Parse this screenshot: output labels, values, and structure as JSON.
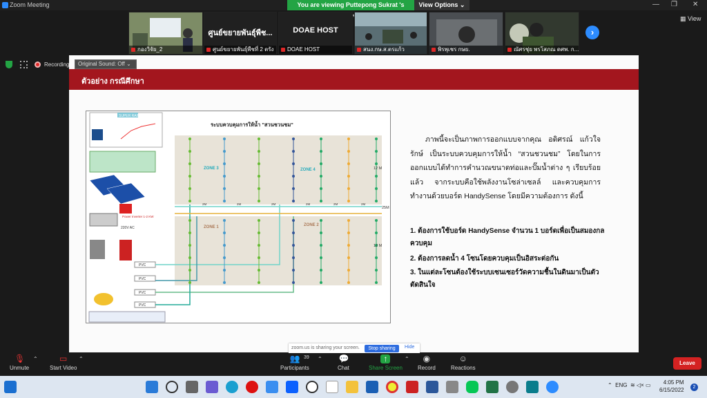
{
  "window": {
    "title": "Zoom Meeting",
    "viewing_banner": "You are viewing Puttepong Sukrat 's screen",
    "view_options": "View Options",
    "view_button": "View"
  },
  "participants_strip": [
    {
      "name": "กองวิจัย_2",
      "big": ""
    },
    {
      "name": "ศูนย์ขยายพันธุ์พืชที่ 2 ตรัง",
      "big": "ศูนย์ขยายพันธุ์พืช..."
    },
    {
      "name": "DOAE HOST",
      "big": "DOAE HOST"
    },
    {
      "name": "สนง.กษ.ส.ตรแก้ว",
      "big": ""
    },
    {
      "name": "พิรพุเชร กษย.",
      "big": ""
    },
    {
      "name": "ณัศรชุ่ย พรโสภณ ดศพ. ก...",
      "big": ""
    }
  ],
  "recording": {
    "label": "Recording",
    "original_sound": "Original Sound: Off"
  },
  "slide": {
    "header": "ตัวอย่าง กรณีศึกษา",
    "diagram": {
      "title": "ระบบควบคุมการให้น้ำ \"สวนชวนชม\"",
      "zones": [
        "ZONE 3",
        "ZONE 4",
        "ZONE 1",
        "ZONE 2"
      ],
      "dist_labels": [
        "2M",
        "2M",
        "2M",
        "2M",
        "2M",
        "2M"
      ],
      "side_labels": [
        "12 M",
        "12 M",
        "25M"
      ],
      "super_rain": "SUPER RAIN",
      "inverter": "Power Inverter 1-2 KW",
      "ac": "220V AC",
      "pvc": "PVC"
    },
    "paragraph": "ภาพนี้จะเป็นภาพการออกแบบจากคุณ อดิศรณ์ แก้วใจรักษ์ เป็นระบบควบคุมการให้น้ำ “สวนชวนชม” โดยในการออกแบบได้ทำการคำนวณขนาดท่อและปั๊มน้ำต่าง ๆ เรียบร้อยแล้ว จากระบบคือใช้พลังงานโซล่าเซลล์ และควบคุมการทำงานด้วยบอร์ด HandySense โดยมีความต้องการ ดังนี้",
    "steps": [
      "1. ต้องการใช้บอร์ด HandySense จำนวน 1 บอร์ดเพื่อเป็นสมองกลควบคุม",
      "2. ต้องการลดน้ำ 4 โซนโดยควบคุมเป็นอิสระต่อกัน",
      "3. ในแต่ละโซนต้องใช้ระบบเซนเซอร์วัดความชื้นในดินมาเป็นตัวตัดสินใจ"
    ]
  },
  "share_bar": {
    "info": "zoom.us is sharing your screen.",
    "stop": "Stop sharing",
    "hide": "Hide"
  },
  "controls": {
    "unmute": "Unmute",
    "start_video": "Start Video",
    "participants": "Participants",
    "participants_count": "39",
    "chat": "Chat",
    "share_screen": "Share Screen",
    "record": "Record",
    "reactions": "Reactions",
    "leave": "Leave"
  },
  "taskbar": {
    "lang": "ENG",
    "time": "4:05 PM",
    "date": "6/15/2022",
    "notifications": "2"
  }
}
